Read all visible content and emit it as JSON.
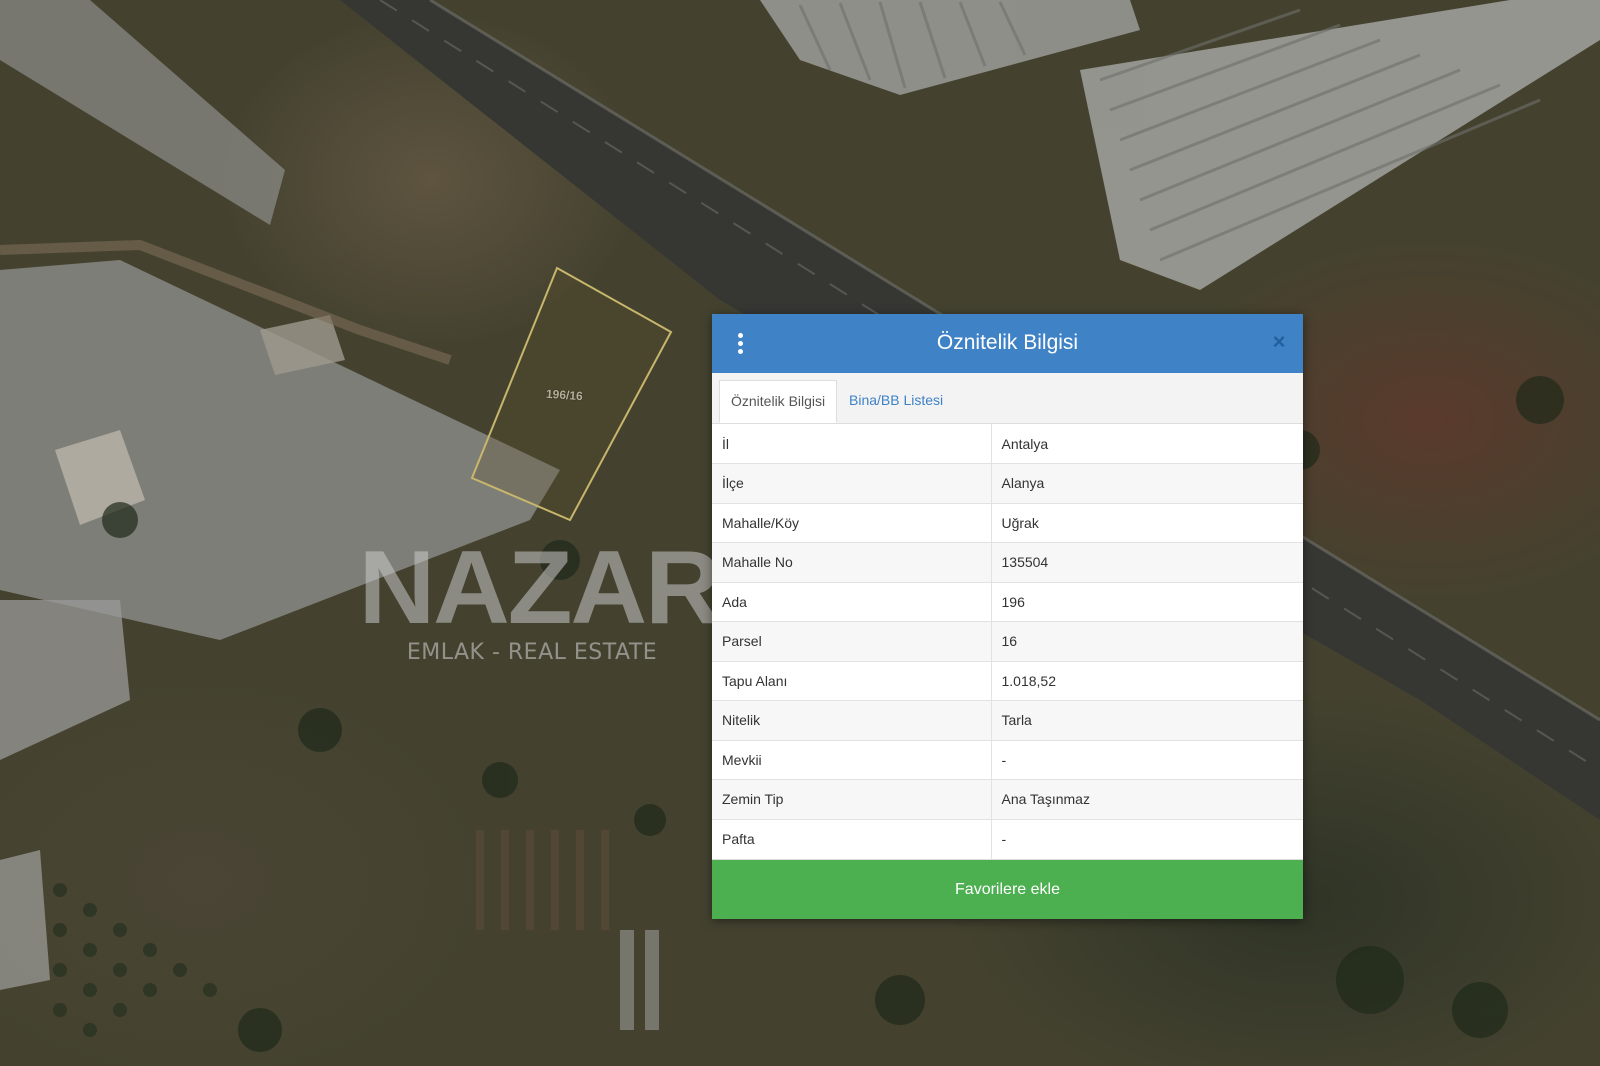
{
  "map": {
    "parcel_label": "196/16"
  },
  "watermark": {
    "word": "NAZAR",
    "subtitle": "EMLAK - REAL ESTATE"
  },
  "popup": {
    "title": "Öznitelik Bilgisi",
    "menu_icon": "vertical-dots-icon",
    "close_icon": "close-icon",
    "close_glyph": "×",
    "header_color": "#3f82c6",
    "tabs": [
      {
        "label": "Öznitelik Bilgisi",
        "active": true
      },
      {
        "label": "Bina/BB Listesi",
        "active": false
      }
    ],
    "rows": [
      {
        "key": "İl",
        "value": "Antalya"
      },
      {
        "key": "İlçe",
        "value": "Alanya"
      },
      {
        "key": "Mahalle/Köy",
        "value": "Uğrak"
      },
      {
        "key": "Mahalle No",
        "value": "135504"
      },
      {
        "key": "Ada",
        "value": "196"
      },
      {
        "key": "Parsel",
        "value": "16"
      },
      {
        "key": "Tapu Alanı",
        "value": "1.018,52"
      },
      {
        "key": "Nitelik",
        "value": "Tarla"
      },
      {
        "key": "Mevkii",
        "value": "-"
      },
      {
        "key": "Zemin Tip",
        "value": "Ana Taşınmaz"
      },
      {
        "key": "Pafta",
        "value": "-"
      }
    ],
    "button_label": "Favorilere ekle",
    "button_color": "#4caf50"
  }
}
